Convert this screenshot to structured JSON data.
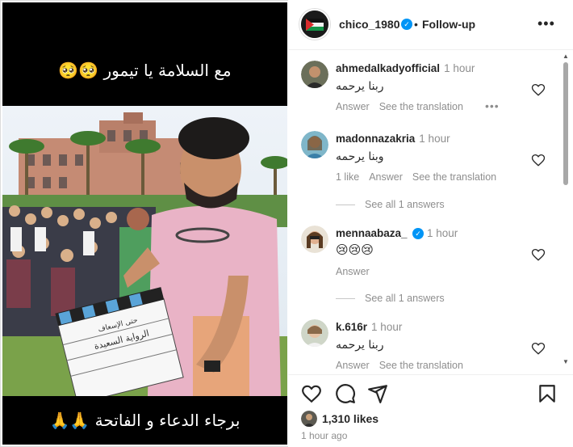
{
  "media": {
    "caption_top": "مع السلامة يا تيمور 🥺🥺",
    "caption_bottom": "برجاء الدعاء و الفاتحة 🙏🙏",
    "clapper_text_1": "حتى الإسعاف",
    "clapper_text_2": "الرواية السعيدة"
  },
  "header": {
    "username": "chico_1980",
    "separator": "•",
    "follow_label": "Follow-up",
    "more_label": "•••"
  },
  "comments": [
    {
      "username": "ahmedalkadyofficial",
      "time": "1 hour",
      "text": "ربنا يرحمه",
      "actions": [
        "Answer",
        "See the translation"
      ],
      "more": "•••"
    },
    {
      "username": "madonnazakria",
      "time": "1 hour",
      "text": "وبنا يرحمه",
      "actions": [
        "1 like",
        "Answer",
        "See the translation"
      ],
      "see_all": "See all 1 answers"
    },
    {
      "username": "mennaabaza_",
      "time": "1 hour",
      "text": "😢😢😢",
      "actions": [
        "Answer"
      ],
      "see_all": "See all 1 answers"
    },
    {
      "username": "k.616r",
      "time": "1 hour",
      "text": "ربنا يرحمه",
      "actions": [
        "Answer",
        "See the translation"
      ]
    }
  ],
  "footer": {
    "likes": "1,310 likes",
    "time": "1 hour ago"
  },
  "colors": {
    "verified": "#0095f6",
    "secondary_text": "#8e8e8e",
    "primary_text": "#262626"
  }
}
